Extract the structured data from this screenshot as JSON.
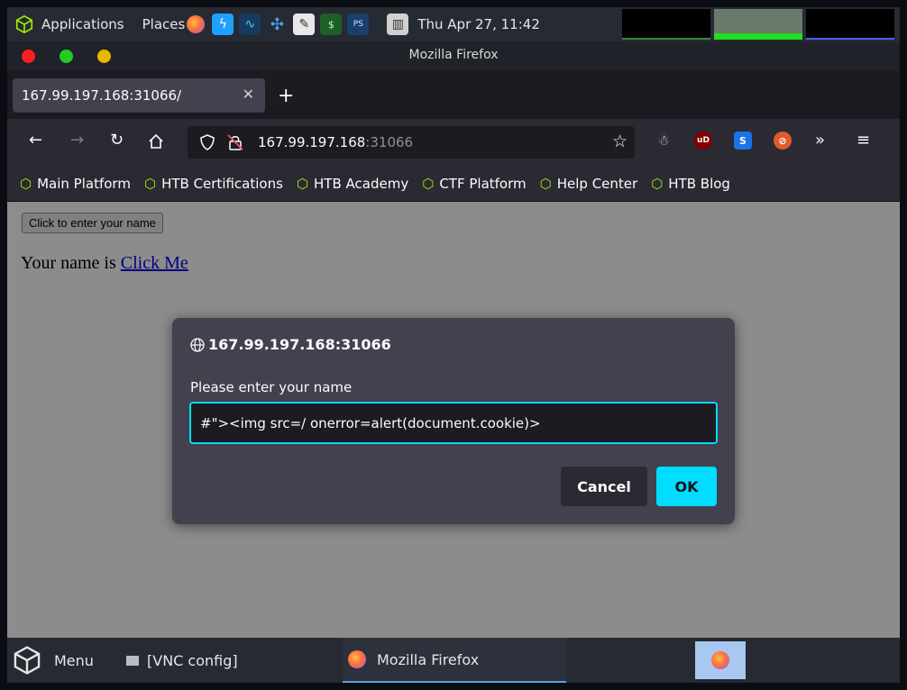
{
  "top_panel": {
    "applications_label": "Applications",
    "places_label": "Places",
    "clock": "Thu Apr 27, 11:42"
  },
  "window": {
    "title": "Mozilla Firefox"
  },
  "browser": {
    "tab_title": "167.99.197.168:31066/",
    "url_host": "167.99.197.168",
    "url_port": ":31066",
    "bookmarks": [
      "Main Platform",
      "HTB Certifications",
      "HTB Academy",
      "CTF Platform",
      "Help Center",
      "HTB Blog"
    ]
  },
  "page": {
    "button_label": "Click to enter your name",
    "name_prefix": "Your name is ",
    "name_link": "Click Me"
  },
  "dialog": {
    "origin": "167.99.197.168:31066",
    "message": "Please enter your name",
    "input_value": "#\"><img src=/ onerror=alert(document.cookie)>",
    "cancel_label": "Cancel",
    "ok_label": "OK"
  },
  "taskbar": {
    "menu_label": "Menu",
    "vnc_label": "[VNC config]",
    "firefox_label": "Mozilla Firefox"
  },
  "colors": {
    "accent": "#00ddff",
    "htb_green": "#9fef00",
    "dialog_bg": "#42414d"
  }
}
